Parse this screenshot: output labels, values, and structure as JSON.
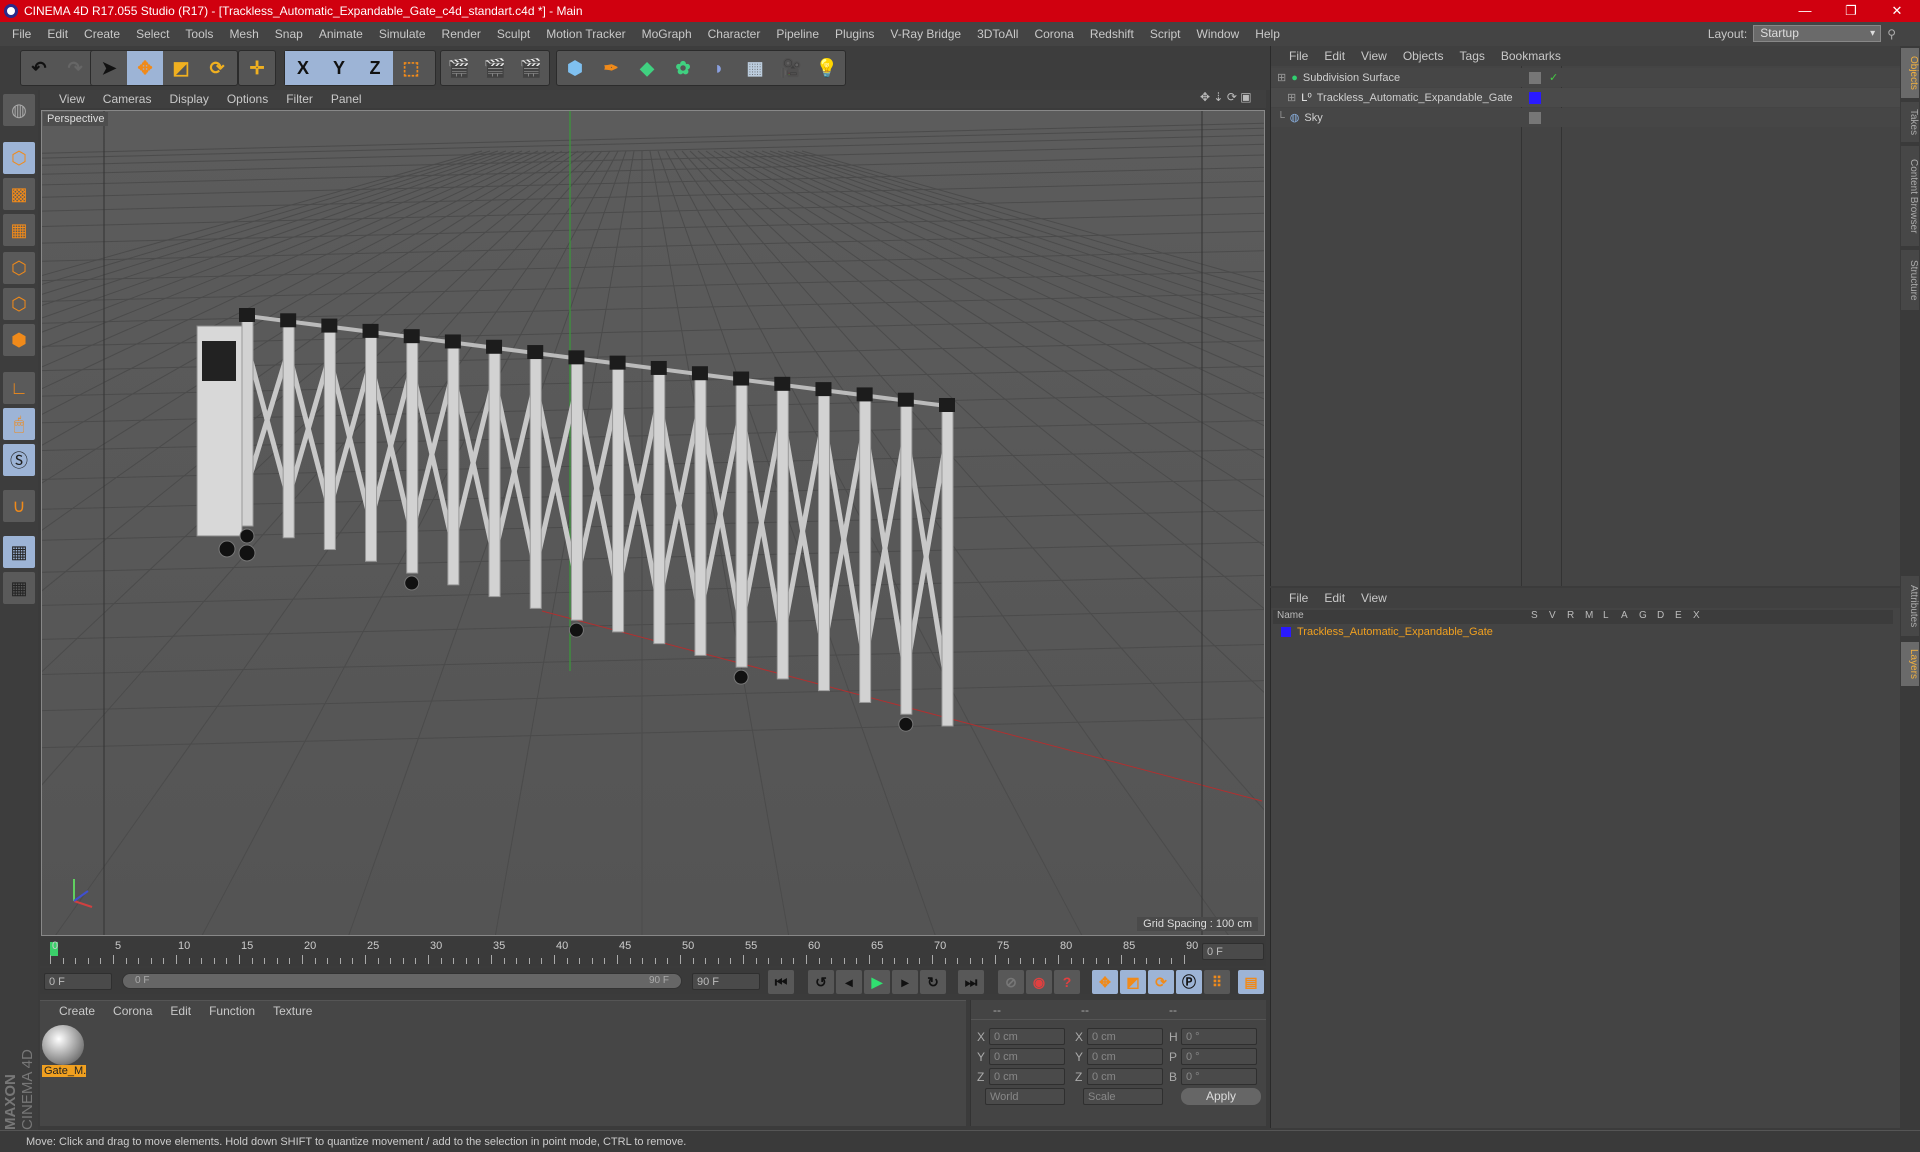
{
  "window": {
    "title": "CINEMA 4D R17.055 Studio (R17) - [Trackless_Automatic_Expandable_Gate_c4d_standart.c4d *] - Main",
    "controls": [
      "minimize",
      "maximize",
      "close"
    ]
  },
  "menubar": {
    "items": [
      "File",
      "Edit",
      "Create",
      "Select",
      "Tools",
      "Mesh",
      "Snap",
      "Animate",
      "Simulate",
      "Render",
      "Sculpt",
      "Motion Tracker",
      "MoGraph",
      "Character",
      "Pipeline",
      "Plugins",
      "V-Ray Bridge",
      "3DToAll",
      "Corona",
      "Redshift",
      "Script",
      "Window",
      "Help"
    ],
    "layout_label": "Layout:",
    "layout_value": "Startup"
  },
  "toolbar": {
    "axis_labels": [
      "X",
      "Y",
      "Z"
    ]
  },
  "viewport": {
    "menu": [
      "View",
      "Cameras",
      "Display",
      "Options",
      "Filter",
      "Panel"
    ],
    "camera_label": "Perspective",
    "grid_spacing": "Grid Spacing : 100 cm"
  },
  "timeline": {
    "ticks": [
      "0",
      "5",
      "10",
      "15",
      "20",
      "25",
      "30",
      "35",
      "40",
      "45",
      "50",
      "55",
      "60",
      "65",
      "70",
      "75",
      "80",
      "85",
      "90"
    ],
    "current_frame": "0 F",
    "start_field": "0 F",
    "range_start": "0 F",
    "range_end": "90 F",
    "end_field": "90 F"
  },
  "material_manager": {
    "menu": [
      "Create",
      "Corona",
      "Edit",
      "Function",
      "Texture"
    ],
    "materials": [
      {
        "name": "Gate_M..."
      }
    ]
  },
  "coordinates": {
    "headers": [
      "--",
      "--",
      "--"
    ],
    "rows": [
      {
        "pos_label": "X",
        "pos": "0 cm",
        "size_label": "X",
        "size": "0 cm",
        "rot_label": "H",
        "rot": "0 °"
      },
      {
        "pos_label": "Y",
        "pos": "0 cm",
        "size_label": "Y",
        "size": "0 cm",
        "rot_label": "P",
        "rot": "0 °"
      },
      {
        "pos_label": "Z",
        "pos": "0 cm",
        "size_label": "Z",
        "size": "0 cm",
        "rot_label": "B",
        "rot": "0 °"
      }
    ],
    "mode": "World",
    "scale_mode": "Scale",
    "apply_label": "Apply"
  },
  "object_manager": {
    "menu": [
      "File",
      "Edit",
      "View",
      "Objects",
      "Tags",
      "Bookmarks"
    ],
    "objects": [
      {
        "name": "Subdivision Surface",
        "icon": "subdivision-icon"
      },
      {
        "name": "Trackless_Automatic_Expandable_Gate",
        "icon": "null-icon",
        "color": "#2a1aff"
      },
      {
        "name": "Sky",
        "icon": "sky-icon"
      }
    ]
  },
  "layer_manager": {
    "menu": [
      "File",
      "Edit",
      "View"
    ],
    "columns": [
      "Name",
      "S",
      "V",
      "R",
      "M",
      "L",
      "A",
      "G",
      "D",
      "E",
      "X"
    ],
    "layers": [
      {
        "name": "Trackless_Automatic_Expandable_Gate",
        "color": "#2a1aff"
      }
    ]
  },
  "side_tabs": [
    "Objects",
    "Takes",
    "Content Browser",
    "Structure",
    "Attributes",
    "Layers"
  ],
  "status": "Move: Click and drag to move elements. Hold down SHIFT to quantize movement / add to the selection in point mode, CTRL to remove.",
  "branding": {
    "maxon": "MAXON",
    "product": "CINEMA 4D"
  },
  "colors": {
    "title_bar": "#d0000f",
    "accent_orange": "#f08a1a",
    "selection_blue": "#9db4d6",
    "highlight": "#f0b040"
  }
}
